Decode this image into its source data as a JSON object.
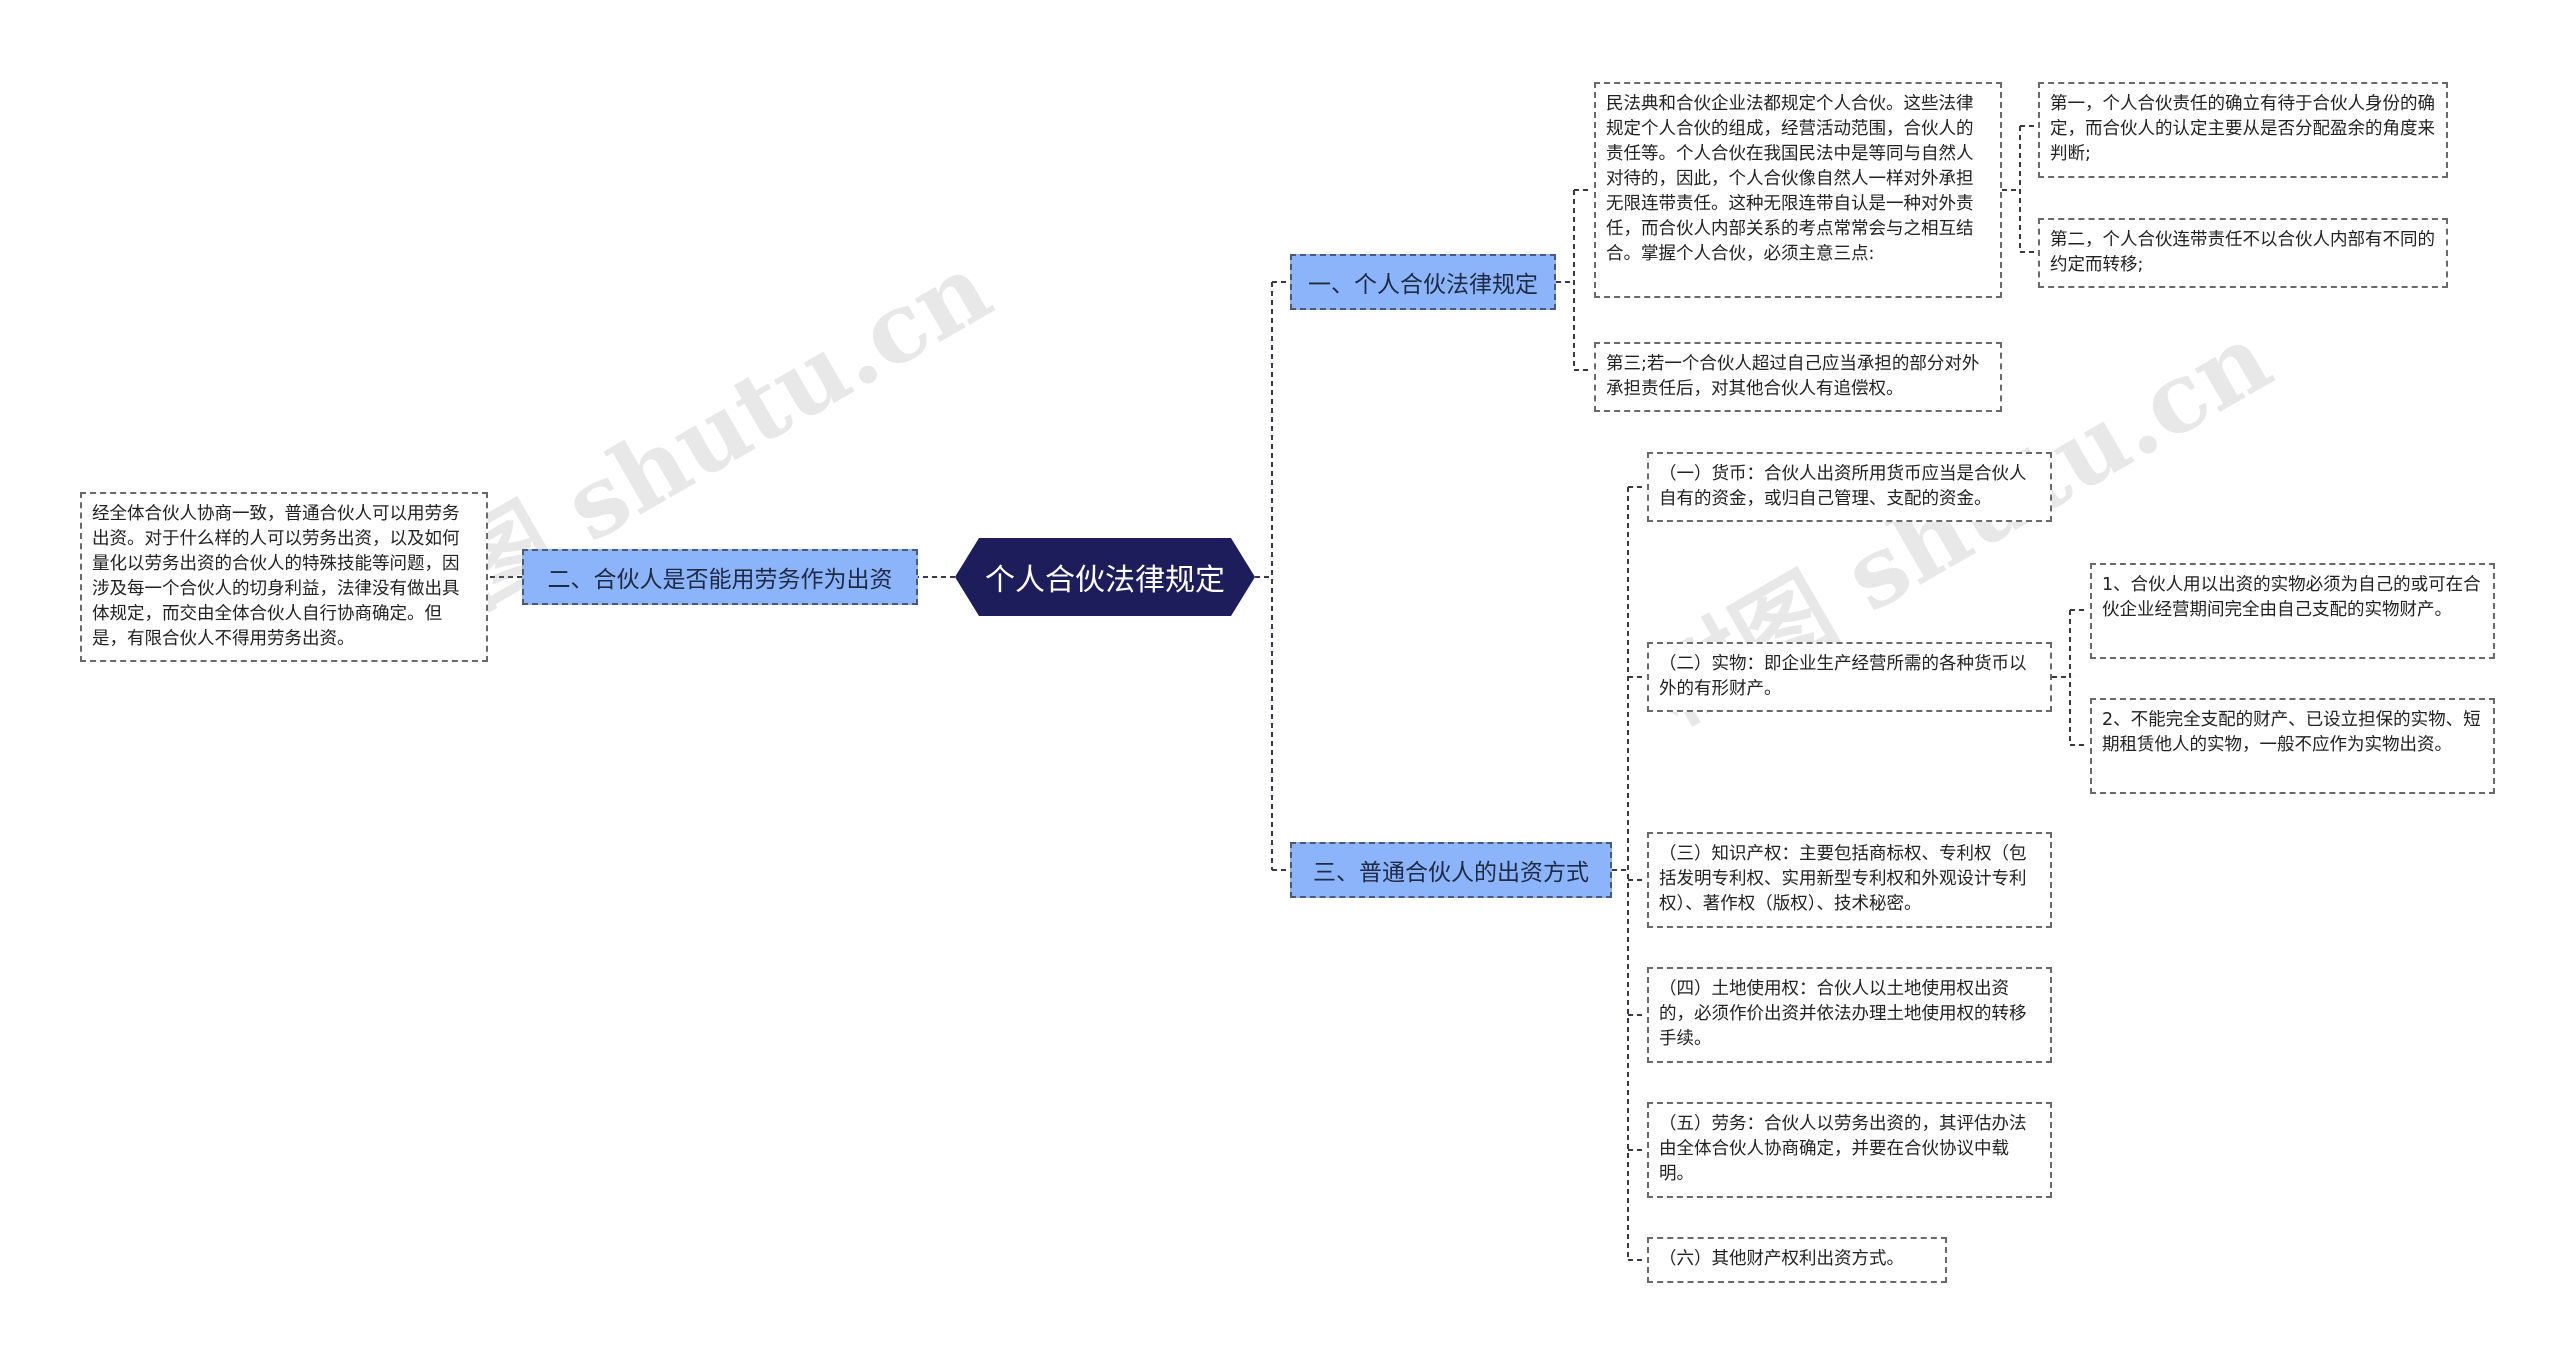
{
  "root": {
    "label": "个人合伙法律规定"
  },
  "branches": {
    "b1": {
      "label": "一、个人合伙法律规定"
    },
    "b2": {
      "label": "二、合伙人是否能用劳务作为出资"
    },
    "b3": {
      "label": "三、普通合伙人的出资方式"
    }
  },
  "leaves": {
    "b1_intro": "民法典和合伙企业法都规定个人合伙。这些法律规定个人合伙的组成，经营活动范围，合伙人的责任等。个人合伙在我国民法中是等同与自然人对待的，因此，个人合伙像自然人一样对外承担无限连带责任。这种无限连带自认是一种对外责任，而合伙人内部关系的考点常常会与之相互结合。掌握个人合伙，必须主意三点:",
    "b1_p1": "第一，个人合伙责任的确立有待于合伙人身份的确定，而合伙人的认定主要从是否分配盈余的角度来判断;",
    "b1_p2": "第二，个人合伙连带责任不以合伙人内部有不同的约定而转移;",
    "b1_p3": "第三;若一个合伙人超过自己应当承担的部分对外承担责任后，对其他合伙人有追偿权。",
    "b2_text": "经全体合伙人协商一致，普通合伙人可以用劳务出资。对于什么样的人可以劳务出资，以及如何量化以劳务出资的合伙人的特殊技能等问题，因涉及每一个合伙人的切身利益，法律没有做出具体规定，而交由全体合伙人自行协商确定。但是，有限合伙人不得用劳务出资。",
    "b3_1": "（一）货币：合伙人出资所用货币应当是合伙人自有的资金，或归自己管理、支配的资金。",
    "b3_2": "（二）实物：即企业生产经营所需的各种货币以外的有形财产。",
    "b3_2a": "1、合伙人用以出资的实物必须为自己的或可在合伙企业经营期间完全由自己支配的实物财产。",
    "b3_2b": "2、不能完全支配的财产、已设立担保的实物、短期租赁他人的实物，一般不应作为实物出资。",
    "b3_3": "（三）知识产权：主要包括商标权、专利权（包括发明专利权、实用新型专利权和外观设计专利权）、著作权（版权）、技术秘密。",
    "b3_4": "（四）土地使用权：合伙人以土地使用权出资的，必须作价出资并依法办理土地使用权的转移手续。",
    "b3_5": "（五）劳务：合伙人以劳务出资的，其评估办法由全体合伙人协商确定，并要在合伙协议中载明。",
    "b3_6": "（六）其他财产权利出资方式。"
  },
  "watermarks": [
    "树图 shutu.cn",
    "树图 shutu.cn"
  ],
  "colors": {
    "root_bg": "#1d1d5c",
    "branch_bg": "#8bb4fb",
    "line": "#3a3a4a",
    "leaf_border": "#6a6a6a"
  }
}
